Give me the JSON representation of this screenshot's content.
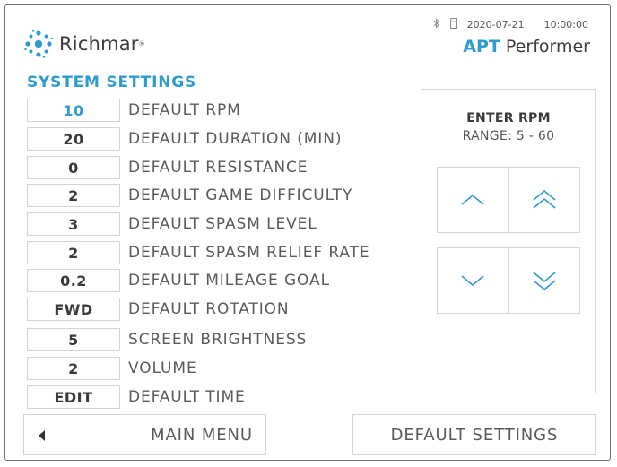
{
  "header": {
    "brand": "Richmar",
    "status": {
      "bluetooth_icon": "bluetooth-icon",
      "storage_icon": "sd-card-icon",
      "date": "2020-07-21",
      "time": "10:00:00"
    },
    "product": {
      "bold": "APT",
      "rest": "Performer"
    }
  },
  "page_title": "SYSTEM SETTINGS",
  "settings": [
    {
      "value": "10",
      "label": "DEFAULT RPM",
      "active": true
    },
    {
      "value": "20",
      "label": "DEFAULT DURATION (MIN)"
    },
    {
      "value": "0",
      "label": "DEFAULT RESISTANCE"
    },
    {
      "value": "2",
      "label": "DEFAULT GAME DIFFICULTY"
    },
    {
      "value": "3",
      "label": "DEFAULT SPASM LEVEL"
    },
    {
      "value": "2",
      "label": "DEFAULT SPASM RELIEF RATE"
    },
    {
      "value": "0.2",
      "label": "DEFAULT MILEAGE GOAL"
    },
    {
      "value": "FWD",
      "label": "DEFAULT ROTATION"
    },
    {
      "value": "5",
      "label": "SCREEN BRIGHTNESS"
    },
    {
      "value": "2",
      "label": "VOLUME"
    },
    {
      "value": "EDIT",
      "label": "DEFAULT TIME"
    }
  ],
  "rpm_panel": {
    "title": "ENTER RPM",
    "range": "RANGE: 5 - 60",
    "icons": [
      "chevron-up-icon",
      "double-chevron-up-icon",
      "chevron-down-icon",
      "double-chevron-down-icon"
    ]
  },
  "footer": {
    "main_menu": "MAIN MENU",
    "default_settings": "DEFAULT SETTINGS"
  },
  "colors": {
    "accent": "#2e9ccf",
    "text": "#5a5a5a",
    "border": "#d3d3d3"
  }
}
